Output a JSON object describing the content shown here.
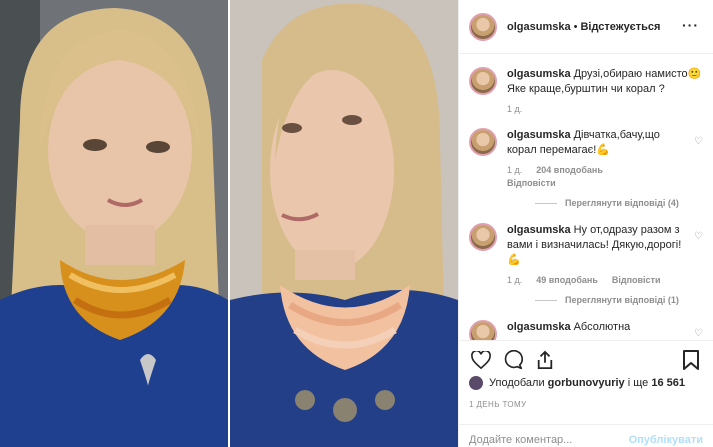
{
  "post": {
    "username": "olgasumska",
    "follow_label": "Відстежується",
    "separator": "•"
  },
  "comments": [
    {
      "user": "olgasumska",
      "text": "Друзі,обираю намисто🙂Яке краще,бурштин чи корал ?",
      "time": "1 д.",
      "likes": "",
      "reply_label": "",
      "view_replies": ""
    },
    {
      "user": "olgasumska",
      "text": "Дівчатка,бачу,що корал перемагає!💪",
      "time": "1 д.",
      "likes": "204 вподобань",
      "reply_label": "Відповісти",
      "view_replies": "Переглянути відповіді (4)"
    },
    {
      "user": "olgasumska",
      "text": "Ну от,одразу разом з вами і визначилась! Дякую,дорогі!💪",
      "time": "1 д.",
      "likes": "49 вподобань",
      "reply_label": "Відповісти",
      "view_replies": "Переглянути відповіді (1)"
    },
    {
      "user": "olgasumska",
      "text": "Абсолютна",
      "time": "",
      "likes": "",
      "reply_label": "",
      "view_replies": ""
    }
  ],
  "likes_line": {
    "prefix": "Уподобали",
    "user": "gorbunovyuriy",
    "middle": "і ще",
    "count": "16 561"
  },
  "timestamp": "1 ДЕНЬ ТОМУ",
  "comment_input": {
    "placeholder": "Додайте коментар...",
    "publish_label": "Опублікувати"
  },
  "colors": {
    "accent_link": "#b2dffc",
    "muted": "#8e8e8e",
    "dress_blue": "#1f3f8f"
  },
  "icons": [
    "more-icon",
    "heart-icon",
    "comment-icon",
    "share-icon",
    "bookmark-icon"
  ]
}
